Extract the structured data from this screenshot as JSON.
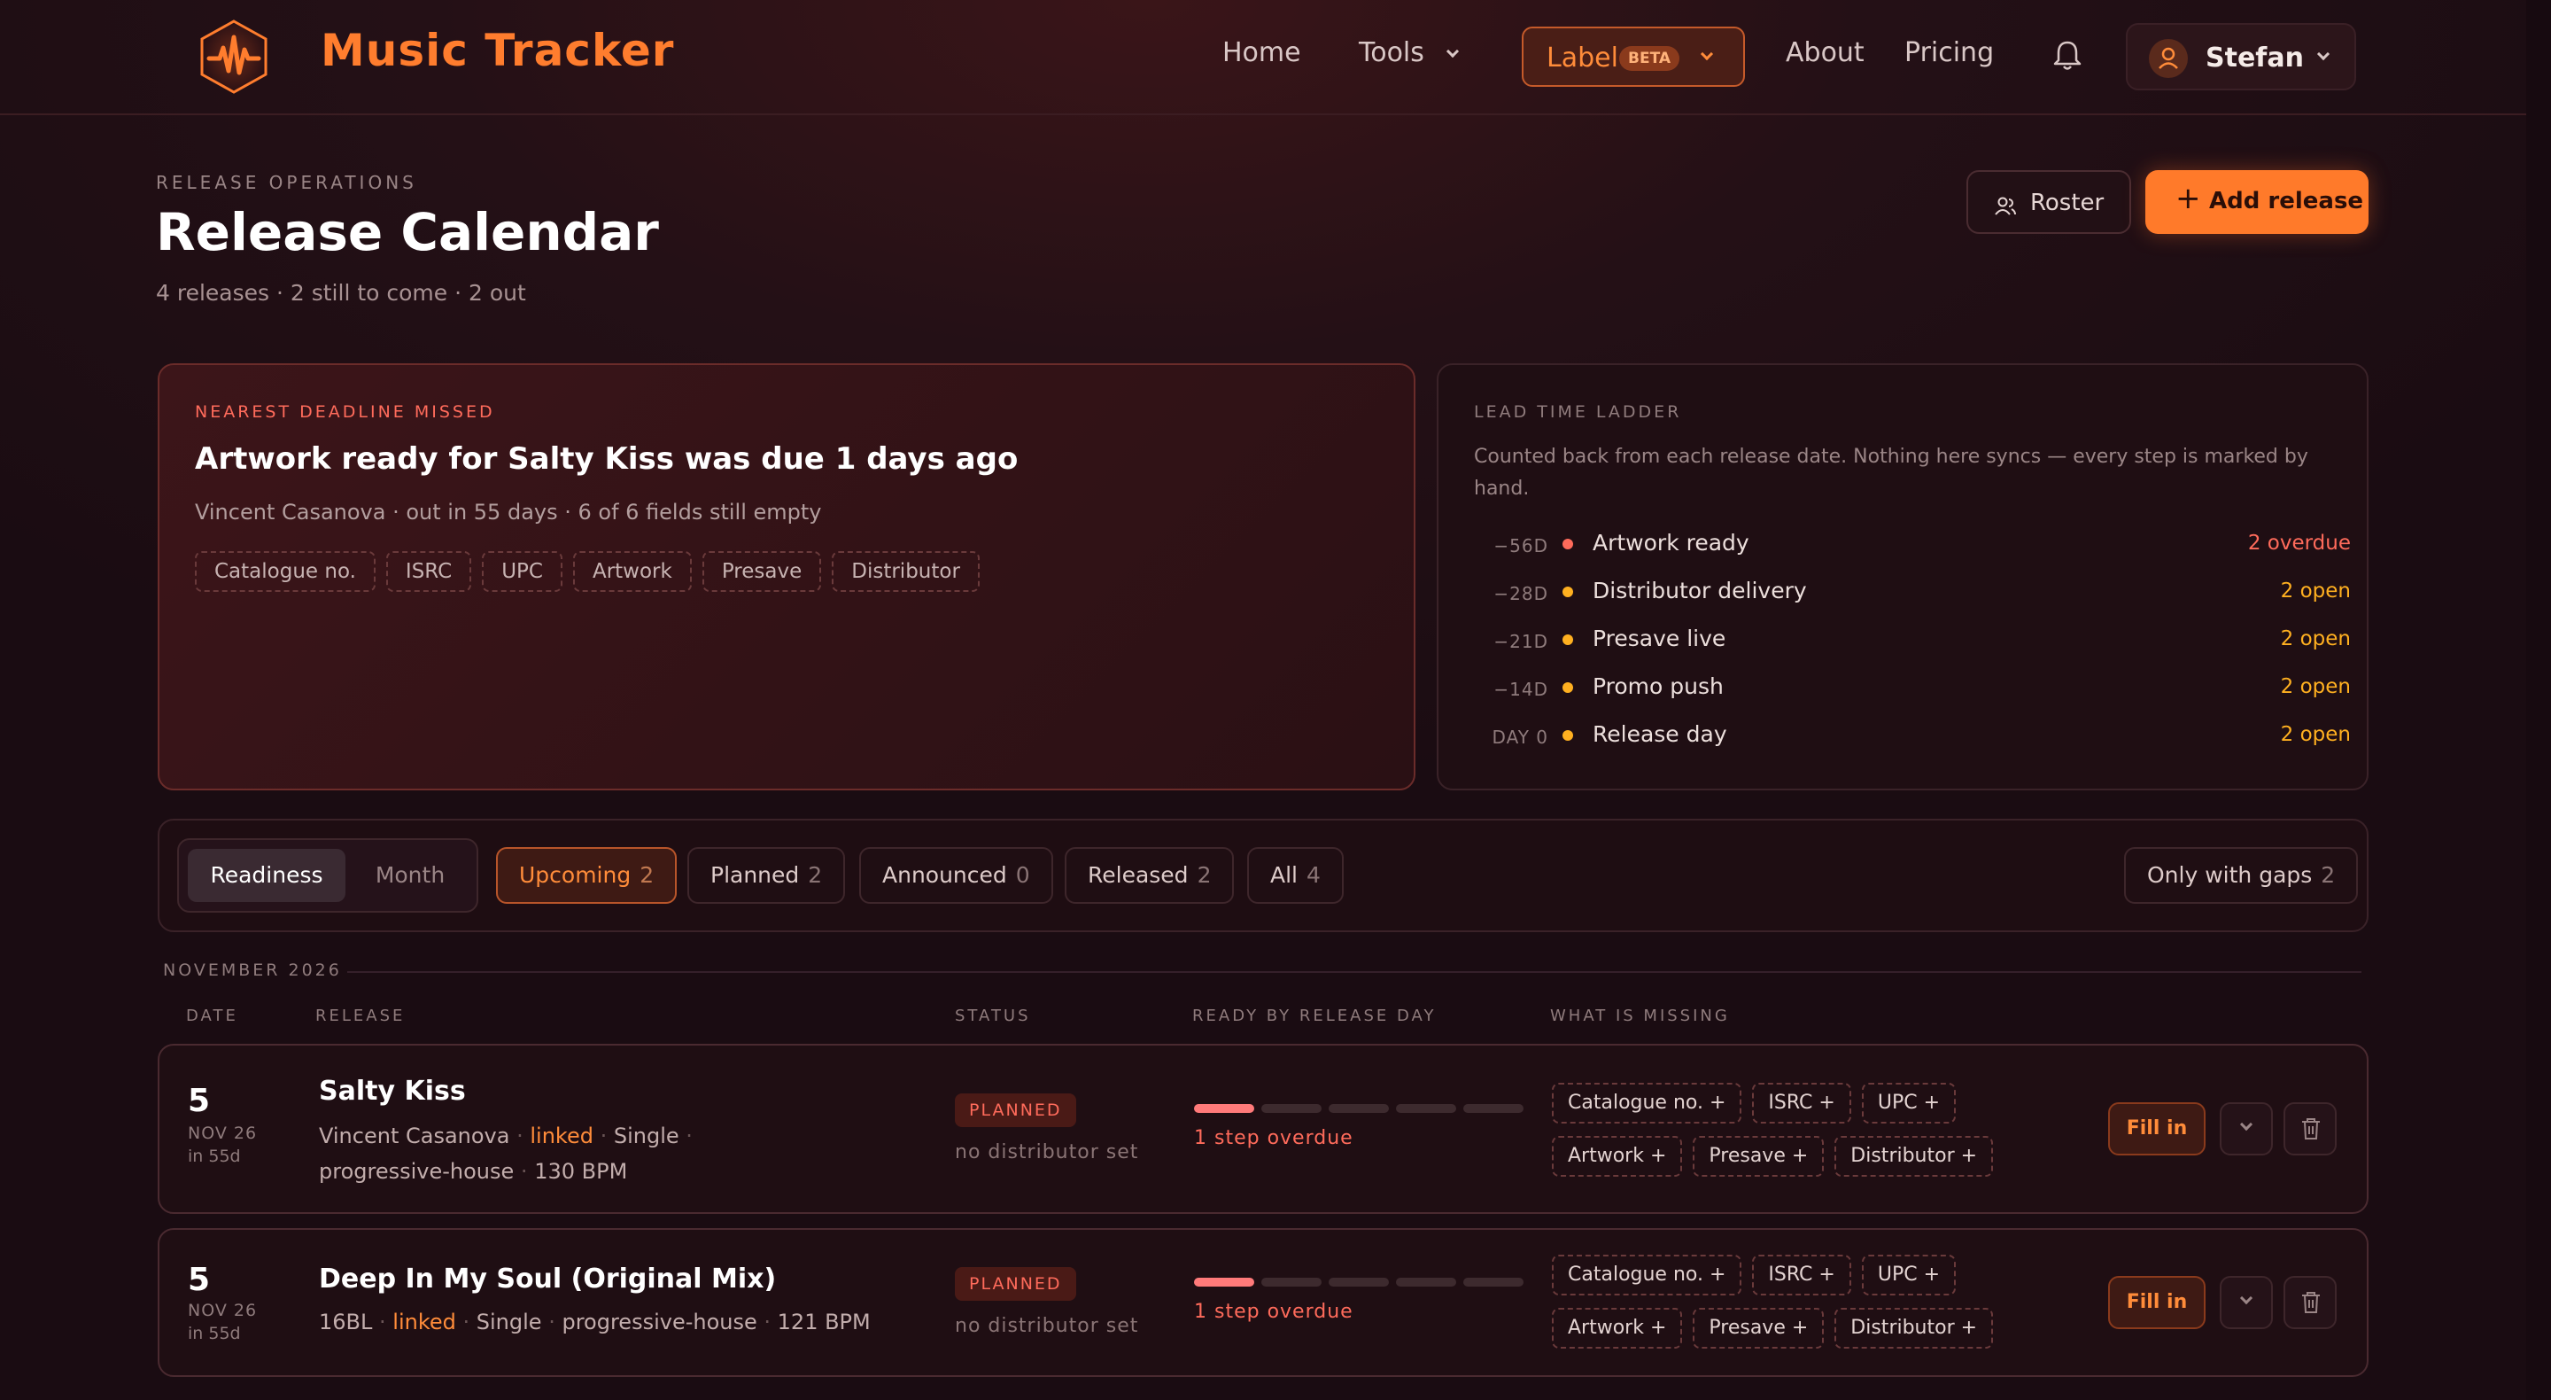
{
  "nav": {
    "brand": "Music Tracker",
    "links": {
      "home": "Home",
      "tools": "Tools",
      "about": "About",
      "pricing": "Pricing"
    },
    "label": {
      "text": "Label",
      "badge": "BETA"
    },
    "user": "Stefan"
  },
  "header": {
    "eyebrow": "RELEASE OPERATIONS",
    "title": "Release Calendar",
    "subtitle": "4 releases · 2 still to come · 2 out",
    "roster_label": "Roster",
    "add_label": "Add release"
  },
  "deadline": {
    "eyebrow": "NEAREST DEADLINE MISSED",
    "title": "Artwork ready for Salty Kiss was due 1 days ago",
    "meta": "Vincent Casanova · out in 55 days · 6 of 6 fields still empty",
    "fields": [
      "Catalogue no.",
      "ISRC",
      "UPC",
      "Artwork",
      "Presave",
      "Distributor"
    ]
  },
  "ladder": {
    "eyebrow": "LEAD TIME LADDER",
    "description": "Counted back from each release date. Nothing here syncs — every step is marked by hand.",
    "steps": [
      {
        "offset": "−56D",
        "name": "Artwork ready",
        "count": "2 overdue",
        "color": "#ff6b5b"
      },
      {
        "offset": "−28D",
        "name": "Distributor delivery",
        "count": "2 open",
        "color": "#ffb020"
      },
      {
        "offset": "−21D",
        "name": "Presave live",
        "count": "2 open",
        "color": "#ffb020"
      },
      {
        "offset": "−14D",
        "name": "Promo push",
        "count": "2 open",
        "color": "#ffb020"
      },
      {
        "offset": "DAY 0",
        "name": "Release day",
        "count": "2 open",
        "color": "#ffb020"
      }
    ]
  },
  "filters": {
    "views": [
      "Readiness",
      "Month"
    ],
    "tabs": [
      {
        "label": "Upcoming",
        "count": "2"
      },
      {
        "label": "Planned",
        "count": "2"
      },
      {
        "label": "Announced",
        "count": "0"
      },
      {
        "label": "Released",
        "count": "2"
      },
      {
        "label": "All",
        "count": "4"
      }
    ],
    "gaps": {
      "label": "Only with gaps",
      "count": "2"
    }
  },
  "table": {
    "month": "NOVEMBER 2026",
    "headers": [
      "DATE",
      "RELEASE",
      "STATUS",
      "READY BY RELEASE DAY",
      "WHAT IS MISSING"
    ],
    "fill_label": "Fill in",
    "rows": [
      {
        "day": "5",
        "month": "NOV 26",
        "in": "in 55d",
        "title": "Salty Kiss",
        "artist": "Vincent Casanova",
        "linked": "linked",
        "type": "Single",
        "genre": "progressive-house",
        "bpm": "130 BPM",
        "status": "PLANNED",
        "distributor": "no distributor set",
        "progress_overdue_steps": 1,
        "progress_total_steps": 5,
        "overdue": "1 step overdue",
        "missing": [
          "Catalogue no. +",
          "ISRC +",
          "UPC +",
          "Artwork +",
          "Presave +",
          "Distributor +"
        ]
      },
      {
        "day": "5",
        "month": "NOV 26",
        "in": "in 55d",
        "title": "Deep In My Soul (Original Mix)",
        "artist": "16BL",
        "linked": "linked",
        "type": "Single",
        "genre": "progressive-house",
        "bpm": "121 BPM",
        "status": "PLANNED",
        "distributor": "no distributor set",
        "progress_overdue_steps": 1,
        "progress_total_steps": 5,
        "overdue": "1 step overdue",
        "missing": [
          "Catalogue no. +",
          "ISRC +",
          "UPC +",
          "Artwork +",
          "Presave +",
          "Distributor +"
        ]
      }
    ]
  }
}
